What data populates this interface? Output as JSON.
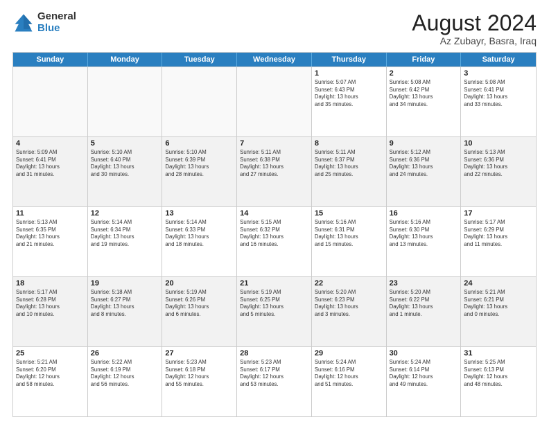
{
  "logo": {
    "general": "General",
    "blue": "Blue"
  },
  "title": "August 2024",
  "subtitle": "Az Zubayr, Basra, Iraq",
  "days": [
    "Sunday",
    "Monday",
    "Tuesday",
    "Wednesday",
    "Thursday",
    "Friday",
    "Saturday"
  ],
  "rows": [
    [
      {
        "day": "",
        "info": "",
        "empty": true
      },
      {
        "day": "",
        "info": "",
        "empty": true
      },
      {
        "day": "",
        "info": "",
        "empty": true
      },
      {
        "day": "",
        "info": "",
        "empty": true
      },
      {
        "day": "1",
        "info": "Sunrise: 5:07 AM\nSunset: 6:43 PM\nDaylight: 13 hours\nand 35 minutes."
      },
      {
        "day": "2",
        "info": "Sunrise: 5:08 AM\nSunset: 6:42 PM\nDaylight: 13 hours\nand 34 minutes."
      },
      {
        "day": "3",
        "info": "Sunrise: 5:08 AM\nSunset: 6:41 PM\nDaylight: 13 hours\nand 33 minutes."
      }
    ],
    [
      {
        "day": "4",
        "info": "Sunrise: 5:09 AM\nSunset: 6:41 PM\nDaylight: 13 hours\nand 31 minutes."
      },
      {
        "day": "5",
        "info": "Sunrise: 5:10 AM\nSunset: 6:40 PM\nDaylight: 13 hours\nand 30 minutes."
      },
      {
        "day": "6",
        "info": "Sunrise: 5:10 AM\nSunset: 6:39 PM\nDaylight: 13 hours\nand 28 minutes."
      },
      {
        "day": "7",
        "info": "Sunrise: 5:11 AM\nSunset: 6:38 PM\nDaylight: 13 hours\nand 27 minutes."
      },
      {
        "day": "8",
        "info": "Sunrise: 5:11 AM\nSunset: 6:37 PM\nDaylight: 13 hours\nand 25 minutes."
      },
      {
        "day": "9",
        "info": "Sunrise: 5:12 AM\nSunset: 6:36 PM\nDaylight: 13 hours\nand 24 minutes."
      },
      {
        "day": "10",
        "info": "Sunrise: 5:13 AM\nSunset: 6:36 PM\nDaylight: 13 hours\nand 22 minutes."
      }
    ],
    [
      {
        "day": "11",
        "info": "Sunrise: 5:13 AM\nSunset: 6:35 PM\nDaylight: 13 hours\nand 21 minutes."
      },
      {
        "day": "12",
        "info": "Sunrise: 5:14 AM\nSunset: 6:34 PM\nDaylight: 13 hours\nand 19 minutes."
      },
      {
        "day": "13",
        "info": "Sunrise: 5:14 AM\nSunset: 6:33 PM\nDaylight: 13 hours\nand 18 minutes."
      },
      {
        "day": "14",
        "info": "Sunrise: 5:15 AM\nSunset: 6:32 PM\nDaylight: 13 hours\nand 16 minutes."
      },
      {
        "day": "15",
        "info": "Sunrise: 5:16 AM\nSunset: 6:31 PM\nDaylight: 13 hours\nand 15 minutes."
      },
      {
        "day": "16",
        "info": "Sunrise: 5:16 AM\nSunset: 6:30 PM\nDaylight: 13 hours\nand 13 minutes."
      },
      {
        "day": "17",
        "info": "Sunrise: 5:17 AM\nSunset: 6:29 PM\nDaylight: 13 hours\nand 11 minutes."
      }
    ],
    [
      {
        "day": "18",
        "info": "Sunrise: 5:17 AM\nSunset: 6:28 PM\nDaylight: 13 hours\nand 10 minutes."
      },
      {
        "day": "19",
        "info": "Sunrise: 5:18 AM\nSunset: 6:27 PM\nDaylight: 13 hours\nand 8 minutes."
      },
      {
        "day": "20",
        "info": "Sunrise: 5:19 AM\nSunset: 6:26 PM\nDaylight: 13 hours\nand 6 minutes."
      },
      {
        "day": "21",
        "info": "Sunrise: 5:19 AM\nSunset: 6:25 PM\nDaylight: 13 hours\nand 5 minutes."
      },
      {
        "day": "22",
        "info": "Sunrise: 5:20 AM\nSunset: 6:23 PM\nDaylight: 13 hours\nand 3 minutes."
      },
      {
        "day": "23",
        "info": "Sunrise: 5:20 AM\nSunset: 6:22 PM\nDaylight: 13 hours\nand 1 minute."
      },
      {
        "day": "24",
        "info": "Sunrise: 5:21 AM\nSunset: 6:21 PM\nDaylight: 13 hours\nand 0 minutes."
      }
    ],
    [
      {
        "day": "25",
        "info": "Sunrise: 5:21 AM\nSunset: 6:20 PM\nDaylight: 12 hours\nand 58 minutes."
      },
      {
        "day": "26",
        "info": "Sunrise: 5:22 AM\nSunset: 6:19 PM\nDaylight: 12 hours\nand 56 minutes."
      },
      {
        "day": "27",
        "info": "Sunrise: 5:23 AM\nSunset: 6:18 PM\nDaylight: 12 hours\nand 55 minutes."
      },
      {
        "day": "28",
        "info": "Sunrise: 5:23 AM\nSunset: 6:17 PM\nDaylight: 12 hours\nand 53 minutes."
      },
      {
        "day": "29",
        "info": "Sunrise: 5:24 AM\nSunset: 6:16 PM\nDaylight: 12 hours\nand 51 minutes."
      },
      {
        "day": "30",
        "info": "Sunrise: 5:24 AM\nSunset: 6:14 PM\nDaylight: 12 hours\nand 49 minutes."
      },
      {
        "day": "31",
        "info": "Sunrise: 5:25 AM\nSunset: 6:13 PM\nDaylight: 12 hours\nand 48 minutes."
      }
    ]
  ]
}
